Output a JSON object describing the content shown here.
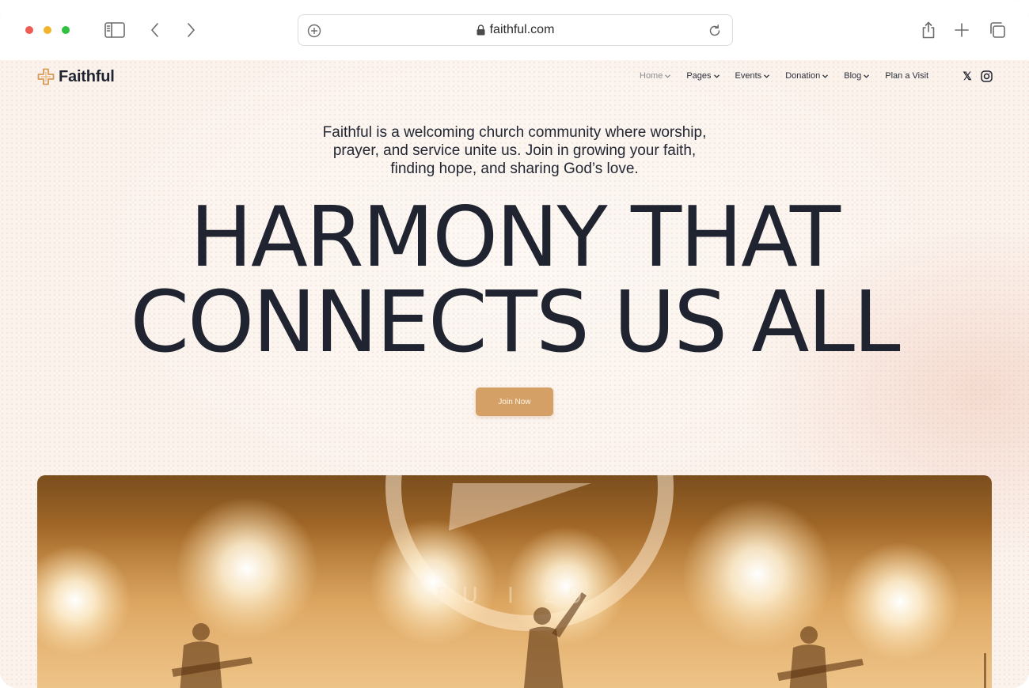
{
  "browser": {
    "url": "faithful.com",
    "icons": [
      "sidebar-icon",
      "chevron-left-icon",
      "chevron-right-icon",
      "new-tab-icon",
      "lock-icon",
      "reload-icon",
      "share-icon",
      "plus-icon",
      "tabs-icon"
    ]
  },
  "site": {
    "brand": "Faithful",
    "accent_color": "#d5a065",
    "nav": [
      {
        "label": "Home",
        "has_dropdown": true,
        "active": true
      },
      {
        "label": "Pages",
        "has_dropdown": true
      },
      {
        "label": "Events",
        "has_dropdown": true
      },
      {
        "label": "Donation",
        "has_dropdown": true
      },
      {
        "label": "Blog",
        "has_dropdown": true
      },
      {
        "label": "Plan a Visit",
        "has_dropdown": false
      }
    ],
    "social": {
      "x": "𝕏"
    },
    "hero": {
      "intro_line1": "Faithful is a welcoming church community where worship,",
      "intro_line2": "prayer, and service unite us. Join in growing your faith,",
      "intro_line3": "finding hope, and sharing God’s love.",
      "title_line1": "HARMONY THAT",
      "title_line2": "CONNECTS US ALL",
      "cta": "Join Now",
      "image_text": "BU    I    29"
    }
  }
}
